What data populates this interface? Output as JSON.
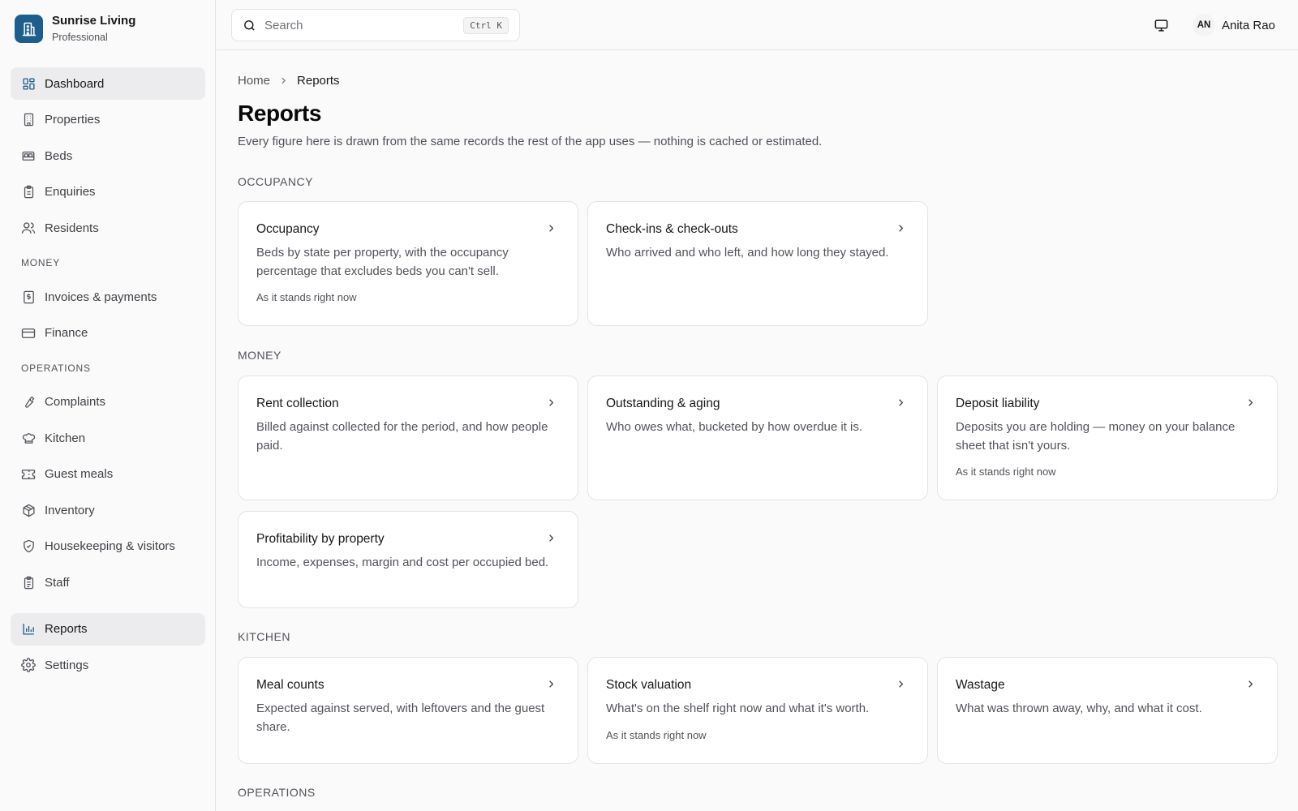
{
  "brand": {
    "name": "Sunrise Living",
    "plan": "Professional",
    "color": "#1d5e8c"
  },
  "sidebar": {
    "primary": [
      {
        "label": "Dashboard",
        "icon": "dashboard-icon",
        "active": true
      },
      {
        "label": "Properties",
        "icon": "building-icon"
      },
      {
        "label": "Beds",
        "icon": "bed-icon"
      },
      {
        "label": "Enquiries",
        "icon": "clipboard-icon"
      },
      {
        "label": "Residents",
        "icon": "users-icon"
      }
    ],
    "money_label": "MONEY",
    "money": [
      {
        "label": "Invoices & payments",
        "icon": "receipt-icon"
      },
      {
        "label": "Finance",
        "icon": "credit-card-icon"
      }
    ],
    "operations_label": "OPERATIONS",
    "operations": [
      {
        "label": "Complaints",
        "icon": "wrench-icon"
      },
      {
        "label": "Kitchen",
        "icon": "chef-hat-icon"
      },
      {
        "label": "Guest meals",
        "icon": "ticket-icon"
      },
      {
        "label": "Inventory",
        "icon": "package-icon"
      },
      {
        "label": "Housekeeping & visitors",
        "icon": "shield-icon"
      },
      {
        "label": "Staff",
        "icon": "clipboard-list-icon"
      }
    ],
    "bottom": [
      {
        "label": "Reports",
        "icon": "bar-chart-icon",
        "active": true
      },
      {
        "label": "Settings",
        "icon": "gear-icon"
      }
    ]
  },
  "topbar": {
    "search_placeholder": "Search",
    "search_shortcut": "Ctrl K",
    "monitor_icon": "monitor-icon",
    "user_initials": "AN",
    "user_name": "Anita Rao"
  },
  "breadcrumb": {
    "home": "Home",
    "current": "Reports"
  },
  "page": {
    "title": "Reports",
    "description": "Every figure here is drawn from the same records the rest of the app uses — nothing is cached or estimated."
  },
  "sections": {
    "occupancy": {
      "label": "OCCUPANCY",
      "cards": [
        {
          "title": "Occupancy",
          "desc": "Beds by state per property, with the occupancy percentage that excludes beds you can't sell.",
          "note": "As it stands right now"
        },
        {
          "title": "Check-ins & check-outs",
          "desc": "Who arrived and who left, and how long they stayed."
        }
      ]
    },
    "money": {
      "label": "MONEY",
      "cards": [
        {
          "title": "Rent collection",
          "desc": "Billed against collected for the period, and how people paid."
        },
        {
          "title": "Outstanding & aging",
          "desc": "Who owes what, bucketed by how overdue it is."
        },
        {
          "title": "Deposit liability",
          "desc": "Deposits you are holding — money on your balance sheet that isn't yours.",
          "note": "As it stands right now"
        },
        {
          "title": "Profitability by property",
          "desc": "Income, expenses, margin and cost per occupied bed."
        }
      ]
    },
    "kitchen": {
      "label": "KITCHEN",
      "cards": [
        {
          "title": "Meal counts",
          "desc": "Expected against served, with leftovers and the guest share."
        },
        {
          "title": "Stock valuation",
          "desc": "What's on the shelf right now and what it's worth.",
          "note": "As it stands right now"
        },
        {
          "title": "Wastage",
          "desc": "What was thrown away, why, and what it cost."
        }
      ]
    },
    "operations": {
      "label": "OPERATIONS"
    }
  }
}
